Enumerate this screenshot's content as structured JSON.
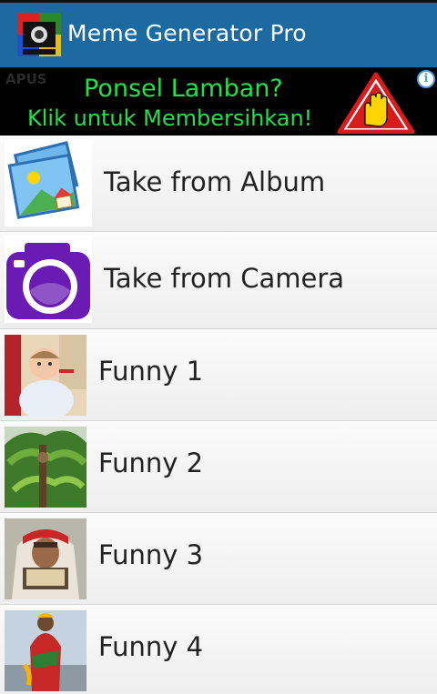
{
  "app": {
    "title": "Meme Generator Pro",
    "icon": "meme-generator-app-icon",
    "header_color": "#1d6aa1"
  },
  "ad": {
    "brand": "APUS",
    "line1": "Ponsel Lamban?",
    "line2": "Klik untuk Membersihkan!",
    "info_glyph": "i",
    "text_color": "#22e04a",
    "warning_color": "#d81b1b",
    "icon": "warning-hand-icon"
  },
  "menu": [
    {
      "label": "Take from Album",
      "icon": "photo-album-icon"
    },
    {
      "label": "Take from Camera",
      "icon": "camera-icon"
    },
    {
      "label": "Funny 1",
      "icon": "baby-photo-thumbnail"
    },
    {
      "label": "Funny 2",
      "icon": "tree-photo-thumbnail"
    },
    {
      "label": "Funny 3",
      "icon": "man-reading-photo-thumbnail"
    },
    {
      "label": "Funny 4",
      "icon": "person-photo-thumbnail"
    }
  ]
}
